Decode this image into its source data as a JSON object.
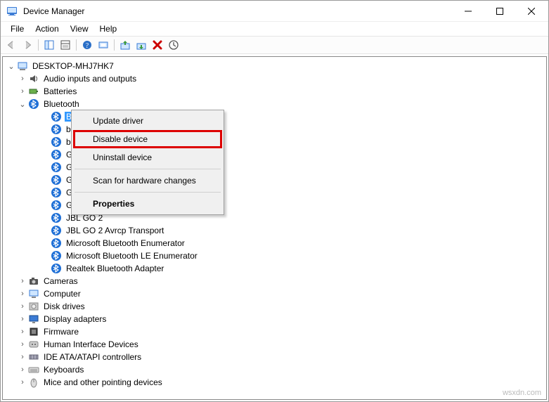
{
  "window_title": "Device Manager",
  "menu": {
    "file": "File",
    "action": "Action",
    "view": "View",
    "help": "Help"
  },
  "root_label": "DESKTOP-MHJ7HK7",
  "categories": [
    {
      "label": "Audio inputs and outputs",
      "icon": "speaker",
      "expanded": false
    },
    {
      "label": "Batteries",
      "icon": "battery",
      "expanded": false
    },
    {
      "label": "Bluetooth",
      "icon": "bluetooth",
      "expanded": true,
      "children": [
        {
          "label": "Blu",
          "selected": true
        },
        {
          "label": "bo"
        },
        {
          "label": "bo"
        },
        {
          "label": "Ga"
        },
        {
          "label": "Ga"
        },
        {
          "label": "Ga"
        },
        {
          "label": "Ga"
        },
        {
          "label": "Galaxy S10 Avrcp Transport"
        },
        {
          "label": "JBL GO 2"
        },
        {
          "label": "JBL GO 2 Avrcp Transport"
        },
        {
          "label": "Microsoft Bluetooth Enumerator"
        },
        {
          "label": "Microsoft Bluetooth LE Enumerator"
        },
        {
          "label": "Realtek Bluetooth Adapter"
        }
      ]
    },
    {
      "label": "Cameras",
      "icon": "camera",
      "expanded": false
    },
    {
      "label": "Computer",
      "icon": "computer",
      "expanded": false
    },
    {
      "label": "Disk drives",
      "icon": "disk",
      "expanded": false
    },
    {
      "label": "Display adapters",
      "icon": "display",
      "expanded": false
    },
    {
      "label": "Firmware",
      "icon": "firmware",
      "expanded": false
    },
    {
      "label": "Human Interface Devices",
      "icon": "hid",
      "expanded": false
    },
    {
      "label": "IDE ATA/ATAPI controllers",
      "icon": "ide",
      "expanded": false
    },
    {
      "label": "Keyboards",
      "icon": "keyboard",
      "expanded": false
    },
    {
      "label": "Mice and other pointing devices",
      "icon": "mouse",
      "expanded": false
    }
  ],
  "context_menu": {
    "update": "Update driver",
    "disable": "Disable device",
    "uninstall": "Uninstall device",
    "scan": "Scan for hardware changes",
    "props": "Properties"
  },
  "watermark": "wsxdn.com"
}
